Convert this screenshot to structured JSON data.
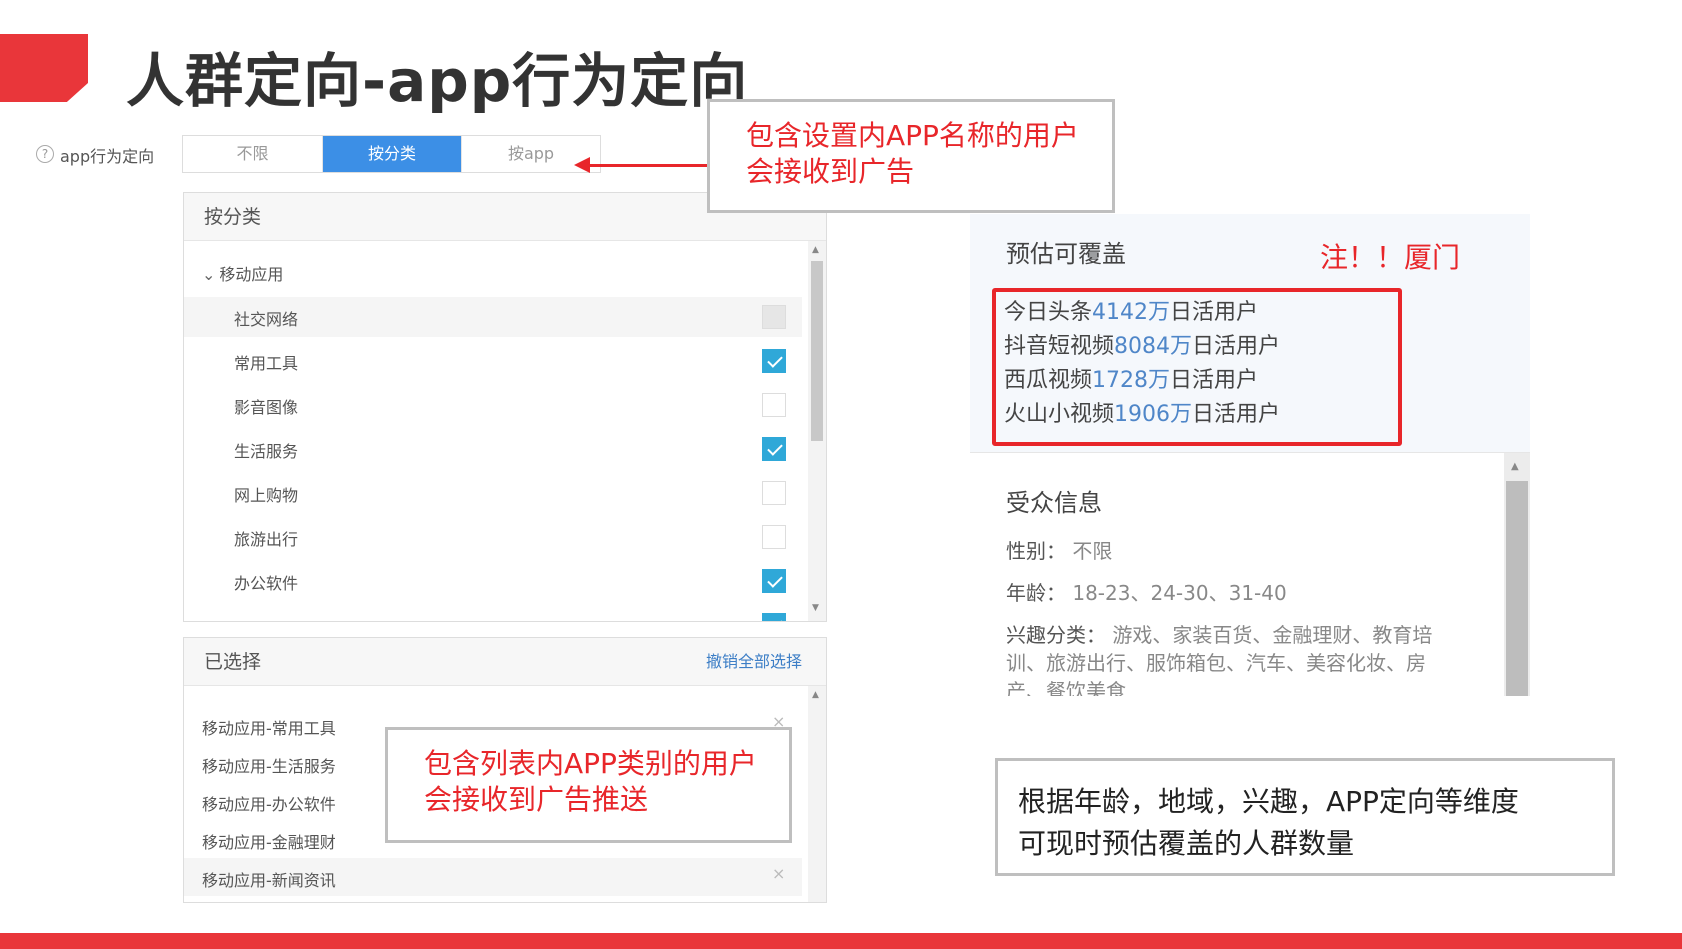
{
  "slide": {
    "title": "人群定向-app行为定向"
  },
  "colors": {
    "accent_red": "#e9363a",
    "active_blue": "#3c8fe6",
    "check_blue": "#2fa8d8",
    "link_blue": "#3c7ec6",
    "number_blue": "#4f86c8"
  },
  "filter": {
    "help_icon": "question-circle-icon",
    "help_glyph": "?",
    "label": "app行为定向",
    "options": [
      "不限",
      "按分类",
      "按app"
    ],
    "selected": "按分类"
  },
  "category_panel": {
    "header": "按分类",
    "group": {
      "chevron": "⌄",
      "label": "移动应用"
    },
    "items": [
      {
        "label": "社交网络",
        "state": "disabled"
      },
      {
        "label": "常用工具",
        "state": "checked"
      },
      {
        "label": "影音图像",
        "state": "unchecked"
      },
      {
        "label": "生活服务",
        "state": "checked"
      },
      {
        "label": "网上购物",
        "state": "unchecked"
      },
      {
        "label": "旅游出行",
        "state": "unchecked"
      },
      {
        "label": "办公软件",
        "state": "checked"
      }
    ]
  },
  "selected_panel": {
    "header": "已选择",
    "undo_all": "撤销全部选择",
    "remove_glyph": "×",
    "items": [
      "移动应用-常用工具",
      "移动应用-生活服务",
      "移动应用-办公软件",
      "移动应用-金融理财",
      "移动应用-新闻资讯"
    ]
  },
  "callouts": {
    "app_name": [
      "包含设置内APP名称的用户",
      "会接收到广告"
    ],
    "app_category": [
      "包含列表内APP类别的用户",
      "会接收到广告推送"
    ],
    "estimate": [
      "根据年龄，地域，兴趣，APP定向等维度",
      "可现时预估覆盖的人群数量"
    ]
  },
  "coverage": {
    "title": "预估可覆盖",
    "note": "注！！厦门",
    "lines": [
      {
        "name": "今日头条",
        "number": "4142万",
        "suffix": "日活用户"
      },
      {
        "name": "抖音短视频",
        "number": "8084万",
        "suffix": "日活用户"
      },
      {
        "name": "西瓜视频",
        "number": "1728万",
        "suffix": "日活用户"
      },
      {
        "name": "火山小视频",
        "number": "1906万",
        "suffix": "日活用户"
      }
    ]
  },
  "audience": {
    "title": "受众信息",
    "gender_label": "性别：",
    "gender_value": "不限",
    "age_label": "年龄：",
    "age_value": "18-23、24-30、31-40",
    "interest_label": "兴趣分类：",
    "interest_value": "游戏、家装百货、金融理财、教育培训、旅游出行、服饰箱包、汽车、美容化妆、房产、餐饮美食"
  }
}
